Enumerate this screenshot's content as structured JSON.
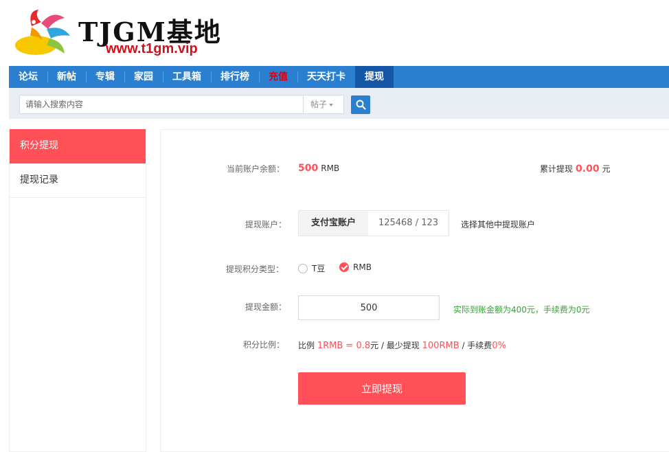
{
  "brand": {
    "title": "TJGM基地",
    "url": "www.t1gm.vip",
    "colors": {
      "url_red": "#d0101a",
      "nav_blue": "#2a7fd0",
      "nav_active": "#1357a6",
      "accent": "#ff5157",
      "hint_green": "#3aa13a"
    }
  },
  "nav": {
    "items": [
      {
        "label": "论坛"
      },
      {
        "label": "新帖"
      },
      {
        "label": "专辑"
      },
      {
        "label": "家园"
      },
      {
        "label": "工具箱"
      },
      {
        "label": "排行榜"
      },
      {
        "label": "充值"
      },
      {
        "label": "天天打卡"
      },
      {
        "label": "提现"
      }
    ],
    "active": "提现",
    "highlighted": "充值"
  },
  "search": {
    "placeholder": "请输入搜索内容",
    "type_label": "帖子",
    "button_icon": "search-icon"
  },
  "sidebar": {
    "items": [
      {
        "label": "积分提现",
        "active": true
      },
      {
        "label": "提现记录",
        "active": false
      }
    ]
  },
  "form": {
    "balance_label": "当前账户余额：",
    "balance_value": "500",
    "balance_unit": "RMB",
    "total_label": "累计提现",
    "total_value": "0.00",
    "total_unit": "元",
    "account_label": "提现账户：",
    "account_name": "支付宝账户",
    "account_number": "125468 / 123",
    "account_other": "选择其他中提现账户",
    "type_label": "提现积分类型：",
    "type_options": [
      {
        "label": "T豆",
        "checked": false
      },
      {
        "label": "RMB",
        "checked": true
      }
    ],
    "amount_label": "提现金额：",
    "amount_value": "500",
    "amount_hint": "实际到账金额为400元，手续费为0元",
    "ratio_label": "积分比例：",
    "ratio": {
      "prefix": "比例",
      "rate": "1RMB = 0.8",
      "rate_unit": "元 / 最少提现",
      "min": "100RMB",
      "fee_text": " / 手续费",
      "fee": "0%"
    },
    "submit_label": "立即提现"
  }
}
